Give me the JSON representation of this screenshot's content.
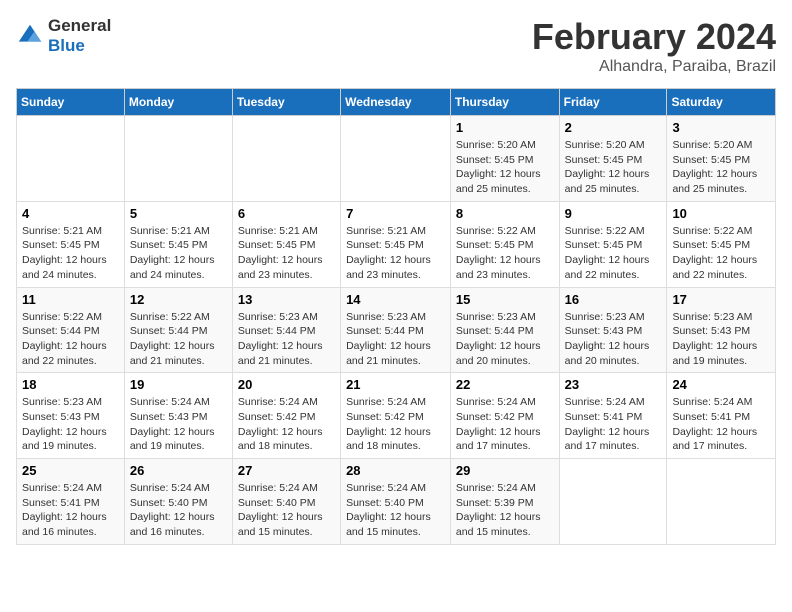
{
  "logo": {
    "line1": "General",
    "line2": "Blue"
  },
  "title": "February 2024",
  "subtitle": "Alhandra, Paraiba, Brazil",
  "days_header": [
    "Sunday",
    "Monday",
    "Tuesday",
    "Wednesday",
    "Thursday",
    "Friday",
    "Saturday"
  ],
  "weeks": [
    [
      {
        "day": "",
        "info": ""
      },
      {
        "day": "",
        "info": ""
      },
      {
        "day": "",
        "info": ""
      },
      {
        "day": "",
        "info": ""
      },
      {
        "day": "1",
        "info": "Sunrise: 5:20 AM\nSunset: 5:45 PM\nDaylight: 12 hours\nand 25 minutes."
      },
      {
        "day": "2",
        "info": "Sunrise: 5:20 AM\nSunset: 5:45 PM\nDaylight: 12 hours\nand 25 minutes."
      },
      {
        "day": "3",
        "info": "Sunrise: 5:20 AM\nSunset: 5:45 PM\nDaylight: 12 hours\nand 25 minutes."
      }
    ],
    [
      {
        "day": "4",
        "info": "Sunrise: 5:21 AM\nSunset: 5:45 PM\nDaylight: 12 hours\nand 24 minutes."
      },
      {
        "day": "5",
        "info": "Sunrise: 5:21 AM\nSunset: 5:45 PM\nDaylight: 12 hours\nand 24 minutes."
      },
      {
        "day": "6",
        "info": "Sunrise: 5:21 AM\nSunset: 5:45 PM\nDaylight: 12 hours\nand 23 minutes."
      },
      {
        "day": "7",
        "info": "Sunrise: 5:21 AM\nSunset: 5:45 PM\nDaylight: 12 hours\nand 23 minutes."
      },
      {
        "day": "8",
        "info": "Sunrise: 5:22 AM\nSunset: 5:45 PM\nDaylight: 12 hours\nand 23 minutes."
      },
      {
        "day": "9",
        "info": "Sunrise: 5:22 AM\nSunset: 5:45 PM\nDaylight: 12 hours\nand 22 minutes."
      },
      {
        "day": "10",
        "info": "Sunrise: 5:22 AM\nSunset: 5:45 PM\nDaylight: 12 hours\nand 22 minutes."
      }
    ],
    [
      {
        "day": "11",
        "info": "Sunrise: 5:22 AM\nSunset: 5:44 PM\nDaylight: 12 hours\nand 22 minutes."
      },
      {
        "day": "12",
        "info": "Sunrise: 5:22 AM\nSunset: 5:44 PM\nDaylight: 12 hours\nand 21 minutes."
      },
      {
        "day": "13",
        "info": "Sunrise: 5:23 AM\nSunset: 5:44 PM\nDaylight: 12 hours\nand 21 minutes."
      },
      {
        "day": "14",
        "info": "Sunrise: 5:23 AM\nSunset: 5:44 PM\nDaylight: 12 hours\nand 21 minutes."
      },
      {
        "day": "15",
        "info": "Sunrise: 5:23 AM\nSunset: 5:44 PM\nDaylight: 12 hours\nand 20 minutes."
      },
      {
        "day": "16",
        "info": "Sunrise: 5:23 AM\nSunset: 5:43 PM\nDaylight: 12 hours\nand 20 minutes."
      },
      {
        "day": "17",
        "info": "Sunrise: 5:23 AM\nSunset: 5:43 PM\nDaylight: 12 hours\nand 19 minutes."
      }
    ],
    [
      {
        "day": "18",
        "info": "Sunrise: 5:23 AM\nSunset: 5:43 PM\nDaylight: 12 hours\nand 19 minutes."
      },
      {
        "day": "19",
        "info": "Sunrise: 5:24 AM\nSunset: 5:43 PM\nDaylight: 12 hours\nand 19 minutes."
      },
      {
        "day": "20",
        "info": "Sunrise: 5:24 AM\nSunset: 5:42 PM\nDaylight: 12 hours\nand 18 minutes."
      },
      {
        "day": "21",
        "info": "Sunrise: 5:24 AM\nSunset: 5:42 PM\nDaylight: 12 hours\nand 18 minutes."
      },
      {
        "day": "22",
        "info": "Sunrise: 5:24 AM\nSunset: 5:42 PM\nDaylight: 12 hours\nand 17 minutes."
      },
      {
        "day": "23",
        "info": "Sunrise: 5:24 AM\nSunset: 5:41 PM\nDaylight: 12 hours\nand 17 minutes."
      },
      {
        "day": "24",
        "info": "Sunrise: 5:24 AM\nSunset: 5:41 PM\nDaylight: 12 hours\nand 17 minutes."
      }
    ],
    [
      {
        "day": "25",
        "info": "Sunrise: 5:24 AM\nSunset: 5:41 PM\nDaylight: 12 hours\nand 16 minutes."
      },
      {
        "day": "26",
        "info": "Sunrise: 5:24 AM\nSunset: 5:40 PM\nDaylight: 12 hours\nand 16 minutes."
      },
      {
        "day": "27",
        "info": "Sunrise: 5:24 AM\nSunset: 5:40 PM\nDaylight: 12 hours\nand 15 minutes."
      },
      {
        "day": "28",
        "info": "Sunrise: 5:24 AM\nSunset: 5:40 PM\nDaylight: 12 hours\nand 15 minutes."
      },
      {
        "day": "29",
        "info": "Sunrise: 5:24 AM\nSunset: 5:39 PM\nDaylight: 12 hours\nand 15 minutes."
      },
      {
        "day": "",
        "info": ""
      },
      {
        "day": "",
        "info": ""
      }
    ]
  ]
}
